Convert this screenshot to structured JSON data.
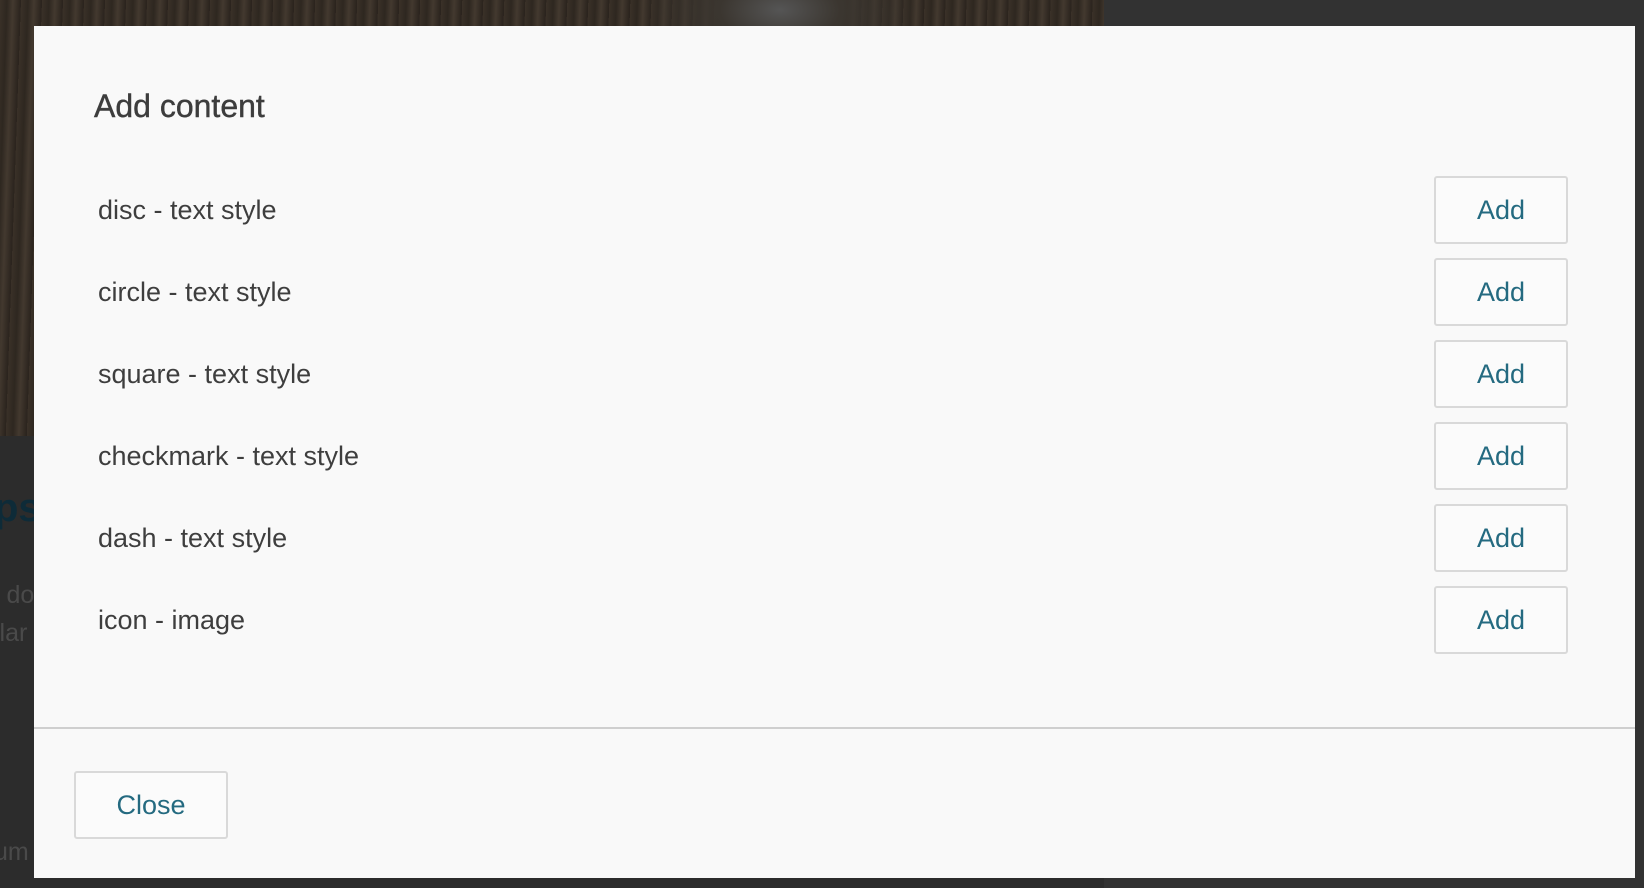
{
  "background": {
    "heading_fragment": "ps",
    "paragraph_fragment": "i do\nllar",
    "footer_fragment": "um"
  },
  "dialog": {
    "title": "Add content",
    "items": [
      {
        "label": "disc - text style",
        "button": "Add"
      },
      {
        "label": "circle - text style",
        "button": "Add"
      },
      {
        "label": "square - text style",
        "button": "Add"
      },
      {
        "label": "checkmark - text style",
        "button": "Add"
      },
      {
        "label": "dash - text style",
        "button": "Add"
      },
      {
        "label": "icon - image",
        "button": "Add"
      }
    ],
    "close_label": "Close"
  },
  "colors": {
    "dialog_background": "#f9f9f9",
    "button_text": "#246a80",
    "button_border": "#d9d9d9",
    "overlay": "#2f2f2f"
  }
}
